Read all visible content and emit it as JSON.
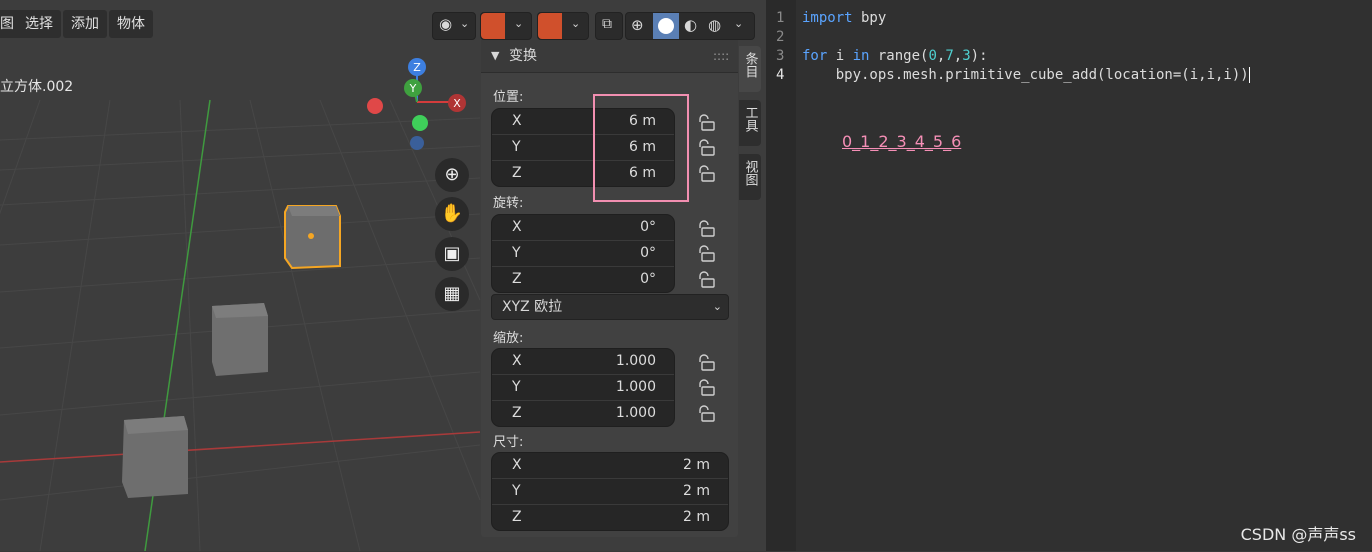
{
  "menu": {
    "view": "图",
    "select": "选择",
    "add": "添加",
    "object": "物体"
  },
  "active_object": "立方体.002",
  "gizmo": {
    "z": "Z",
    "y": "Y",
    "x": "X"
  },
  "npanel": {
    "header": "变换",
    "location_label": "位置:",
    "location": [
      {
        "axis": "X",
        "value": "6 m"
      },
      {
        "axis": "Y",
        "value": "6 m"
      },
      {
        "axis": "Z",
        "value": "6 m"
      }
    ],
    "rotation_label": "旋转:",
    "rotation": [
      {
        "axis": "X",
        "value": "0°"
      },
      {
        "axis": "Y",
        "value": "0°"
      },
      {
        "axis": "Z",
        "value": "0°"
      }
    ],
    "rotation_mode": "XYZ 欧拉",
    "scale_label": "缩放:",
    "scale": [
      {
        "axis": "X",
        "value": "1.000"
      },
      {
        "axis": "Y",
        "value": "1.000"
      },
      {
        "axis": "Z",
        "value": "1.000"
      }
    ],
    "dimensions_label": "尺寸:",
    "dimensions": [
      {
        "axis": "X",
        "value": "2 m"
      },
      {
        "axis": "Y",
        "value": "2 m"
      },
      {
        "axis": "Z",
        "value": "2 m"
      }
    ]
  },
  "side_tabs": [
    "条目",
    "工具",
    "视图"
  ],
  "editor": {
    "line_numbers": [
      "1",
      "2",
      "3",
      "4"
    ],
    "line1_kw": "import",
    "line1_rest": " bpy",
    "line3_for": "for",
    "line3_i": " i ",
    "line3_in": "in",
    "line3_range": " range(",
    "line3_a": "0",
    "line3_b": "7",
    "line3_c": "3",
    "line3_end": "):",
    "line4": "    bpy.ops.mesh.primitive_cube_add(location=(i,i,i))",
    "annotation": "0_1_2_3_4_5_6"
  },
  "watermark": "CSDN @声声ss",
  "colors": {
    "highlight_box": "#f28fb1",
    "selected_outline": "#f5a623",
    "x_axis": "#d43c3c",
    "y_axis": "#3fa13f",
    "z_axis": "#3d7fe0"
  }
}
